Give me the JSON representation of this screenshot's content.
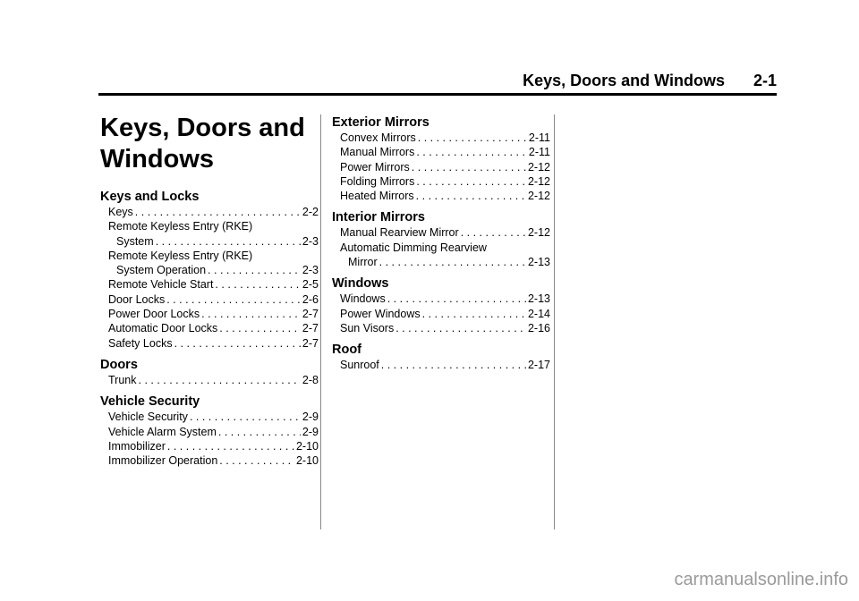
{
  "header": {
    "title": "Keys, Doors and Windows",
    "page": "2-1"
  },
  "chapter_title": "Keys, Doors and Windows",
  "columns": [
    {
      "sections": [
        {
          "heading": "Keys and Locks",
          "entries": [
            {
              "label": "Keys",
              "page": "2-2"
            },
            {
              "label_line1": "Remote Keyless Entry (RKE)",
              "label": "System",
              "page": "2-3"
            },
            {
              "label_line1": "Remote Keyless Entry (RKE)",
              "label": "System Operation",
              "page": "2-3"
            },
            {
              "label": "Remote Vehicle Start",
              "page": "2-5"
            },
            {
              "label": "Door Locks",
              "page": "2-6"
            },
            {
              "label": "Power Door Locks",
              "page": "2-7"
            },
            {
              "label": "Automatic Door Locks",
              "page": "2-7"
            },
            {
              "label": "Safety Locks",
              "page": "2-7"
            }
          ]
        },
        {
          "heading": "Doors",
          "entries": [
            {
              "label": "Trunk",
              "page": "2-8"
            }
          ]
        },
        {
          "heading": "Vehicle Security",
          "entries": [
            {
              "label": "Vehicle Security",
              "page": "2-9"
            },
            {
              "label": "Vehicle Alarm System",
              "page": "2-9"
            },
            {
              "label": "Immobilizer",
              "page": "2-10"
            },
            {
              "label": "Immobilizer Operation",
              "page": "2-10"
            }
          ]
        }
      ]
    },
    {
      "sections": [
        {
          "heading": "Exterior Mirrors",
          "entries": [
            {
              "label": "Convex Mirrors",
              "page": "2-11"
            },
            {
              "label": "Manual Mirrors",
              "page": "2-11"
            },
            {
              "label": "Power Mirrors",
              "page": "2-12"
            },
            {
              "label": "Folding Mirrors",
              "page": "2-12"
            },
            {
              "label": "Heated Mirrors",
              "page": "2-12"
            }
          ]
        },
        {
          "heading": "Interior Mirrors",
          "entries": [
            {
              "label": "Manual Rearview Mirror",
              "page": "2-12"
            },
            {
              "label_line1": "Automatic Dimming Rearview",
              "label": "Mirror",
              "page": "2-13"
            }
          ]
        },
        {
          "heading": "Windows",
          "entries": [
            {
              "label": "Windows",
              "page": "2-13"
            },
            {
              "label": "Power Windows",
              "page": "2-14"
            },
            {
              "label": "Sun Visors",
              "page": "2-16"
            }
          ]
        },
        {
          "heading": "Roof",
          "entries": [
            {
              "label": "Sunroof",
              "page": "2-17"
            }
          ]
        }
      ]
    }
  ],
  "watermark": "carmanualsonline.info"
}
